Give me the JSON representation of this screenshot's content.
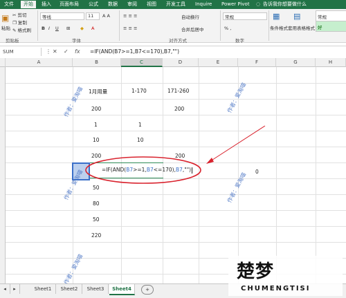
{
  "ribbon": {
    "tabs": [
      "文件",
      "开始",
      "插入",
      "页面布局",
      "公式",
      "数据",
      "审阅",
      "视图",
      "开发工具",
      "Inquire",
      "Power Pivot"
    ],
    "active_tab": "开始",
    "tell_me": "告诉我你想要做什么",
    "clipboard": {
      "cut": "剪切",
      "copy": "复制",
      "format_painter": "格式刷",
      "paste": "粘贴",
      "group": "剪贴板"
    },
    "font": {
      "name": "等线",
      "size": "11",
      "group": "字体"
    },
    "alignment": {
      "wrap": "自动换行",
      "merge": "合并后居中",
      "group": "对齐方式"
    },
    "number": {
      "format": "常规",
      "group": "数字"
    },
    "styles": {
      "conditional": "条件格式",
      "table": "套用表格格式",
      "normal": "常规",
      "good": "好"
    }
  },
  "formula_bar": {
    "name_box": "SUM",
    "fx": "fx",
    "formula": "=IF(AND(B7>=1,B7<=170),B7,\"\")"
  },
  "columns": [
    "A",
    "B",
    "C",
    "D",
    "E",
    "F",
    "G",
    "H"
  ],
  "cells": {
    "b2": "1月用量",
    "c2": "1-170",
    "d2": "171-260",
    "b3": "200",
    "d3": "200",
    "b4": "1",
    "c4": "1",
    "b5": "10",
    "c5": "10",
    "b6": "200",
    "d6": "200",
    "f7": "0",
    "b8": "50",
    "b9": "80",
    "b10": "50",
    "b11": "220"
  },
  "edit_formula": {
    "p1": "=IF(AND(",
    "ref1": "B7",
    "p2": ">=1,",
    "ref2": "B7",
    "p3": "<=170),",
    "ref3": "B7",
    "p4": ",\"\")"
  },
  "watermark": "作者：爱淘喵",
  "sheets": [
    "Sheet1",
    "Sheet2",
    "Sheet3",
    "Sheet4"
  ],
  "active_sheet": "Sheet4",
  "add_sheet": "+",
  "logo": {
    "zh": "楚梦",
    "en": "CHUMENGTISI"
  },
  "colors": {
    "accent": "#217346",
    "annotation": "#d9232e",
    "ref_blue": "#3a6fc8",
    "ref_green": "#2e8b57"
  }
}
